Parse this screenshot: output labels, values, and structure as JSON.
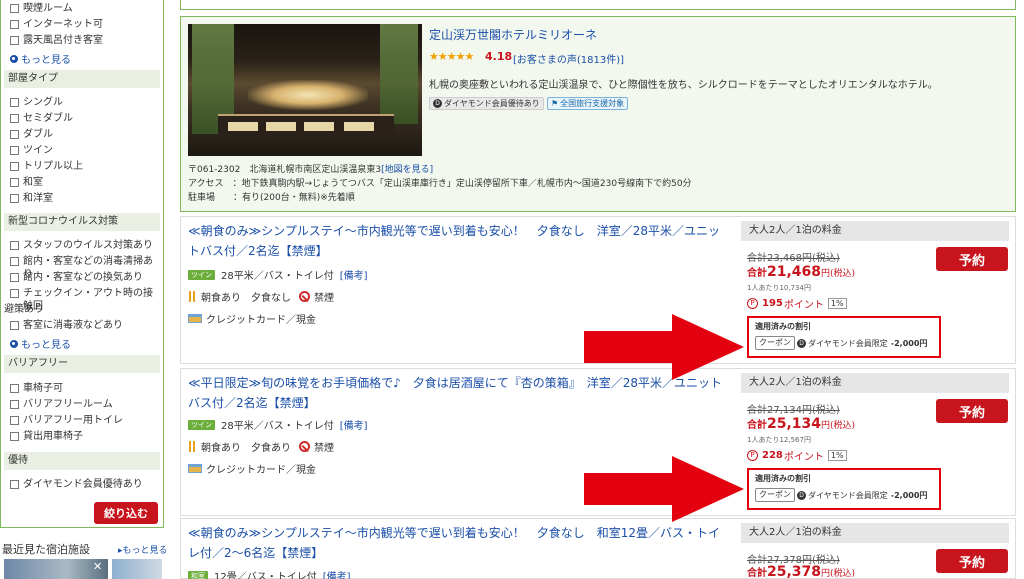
{
  "sidebar": {
    "equip_items": [
      "喫煙ルーム",
      "インターネット可",
      "露天風呂付き客室"
    ],
    "more1": "もっと見る",
    "room_type_header": "部屋タイプ",
    "room_types": [
      "シングル",
      "セミダブル",
      "ダブル",
      "ツイン",
      "トリプル以上",
      "和室",
      "和洋室"
    ],
    "covid_header": "新型コロナウイルス対策",
    "covid_items": [
      "スタッフのウイルス対策あり",
      "館内・客室などの消毒清掃あり",
      "館内・客室などの換気あり",
      "チェックイン・アウト時の接触回",
      "避策あり",
      "客室に消毒液などあり"
    ],
    "more2": "もっと見る",
    "barrier_header": "バリアフリー",
    "barrier_items": [
      "車椅子可",
      "バリアフリールーム",
      "バリアフリー用トイレ",
      "貸出用車椅子"
    ],
    "perk_header": "優待",
    "perk_items": [
      "ダイヤモンド会員優待あり"
    ],
    "filter_button": "絞り込む",
    "recent_title": "最近見た宿泊施設",
    "recent_more": "もっと見る"
  },
  "hotel": {
    "name": "定山渓万世閣ホテルミリオーネ",
    "rating": "4.18",
    "reviews": "[お客さまの声(1813件)]",
    "description": "札幌の奥座敷といわれる定山渓温泉で、ひと際個性を放ち、シルクロードをテーマとしたオリエンタルなホテル。",
    "badge_diamond": "ダイヤモンド会員優待あり",
    "badge_travel": "全国旅行支援対象",
    "address": "〒061-2302　北海道札幌市南区定山渓温泉東3",
    "map_link": "[地図を見る]",
    "access": "アクセス　：地下鉄真駒内駅→じょうてつバス「定山渓車庫行き」定山渓停留所下車／札幌市内〜国道230号線南下で約50分",
    "parking": "駐車場　　：有り(200台・無料)※先着順"
  },
  "plans": [
    {
      "title": "≪朝食のみ≫シンプルステイ〜市内観光等で遅い到着も安心！　夕食なし　洋室／28平米／ユニットバス付／2名迄【禁煙】",
      "room_tag": "ツイン",
      "room": "28平米／バス・トイレ付",
      "note": "[備考]",
      "meal": "朝食あり　夕食なし",
      "smoke": "禁煙",
      "payment": "クレジットカード／現金",
      "price_header": "大人2人／1泊の料金",
      "orig_price": "合計23,468円(税込)",
      "total_prefix": "合計",
      "total_amount": "21,468",
      "total_suffix": "円(税込)",
      "per_person": "1人あたり10,734円",
      "points": "195",
      "points_label": "ポイント",
      "points_pct": "1%",
      "reserve": "予約",
      "discount_title": "適用済みの割引",
      "coupon": "クーポン",
      "discount_text": "ダイヤモンド会員限定",
      "discount_amount": "-2,000円"
    },
    {
      "title": "≪平日限定≫旬の味覚をお手頃価格で♪　夕食は居酒屋にて『杏の策箱』　洋室／28平米／ユニットバス付／2名迄【禁煙】",
      "room_tag": "ツイン",
      "room": "28平米／バス・トイレ付",
      "note": "[備考]",
      "meal": "朝食あり　夕食あり",
      "smoke": "禁煙",
      "payment": "クレジットカード／現金",
      "price_header": "大人2人／1泊の料金",
      "orig_price": "合計27,134円(税込)",
      "total_prefix": "合計",
      "total_amount": "25,134",
      "total_suffix": "円(税込)",
      "per_person": "1人あたり12,567円",
      "points": "228",
      "points_label": "ポイント",
      "points_pct": "1%",
      "reserve": "予約",
      "discount_title": "適用済みの割引",
      "coupon": "クーポン",
      "discount_text": "ダイヤモンド会員限定",
      "discount_amount": "-2,000円"
    },
    {
      "title": "≪朝食のみ≫シンプルステイ〜市内観光等で遅い到着も安心！　夕食なし　和室12畳／バス・トイレ付／2〜6名迄【禁煙】",
      "room_tag": "和室",
      "room": "12畳／バス・トイレ付",
      "note": "[備考]",
      "price_header": "大人2人／1泊の料金",
      "orig_price": "合計27,378円(税込)",
      "total_prefix": "合計",
      "total_amount": "25,378",
      "total_suffix": "円(税込)",
      "reserve": "予約"
    }
  ],
  "colors": {
    "accent_red": "#c8151d",
    "link_blue": "#1a4fa8",
    "border_green": "#7fb85a",
    "arrow_red": "#e3000f"
  }
}
